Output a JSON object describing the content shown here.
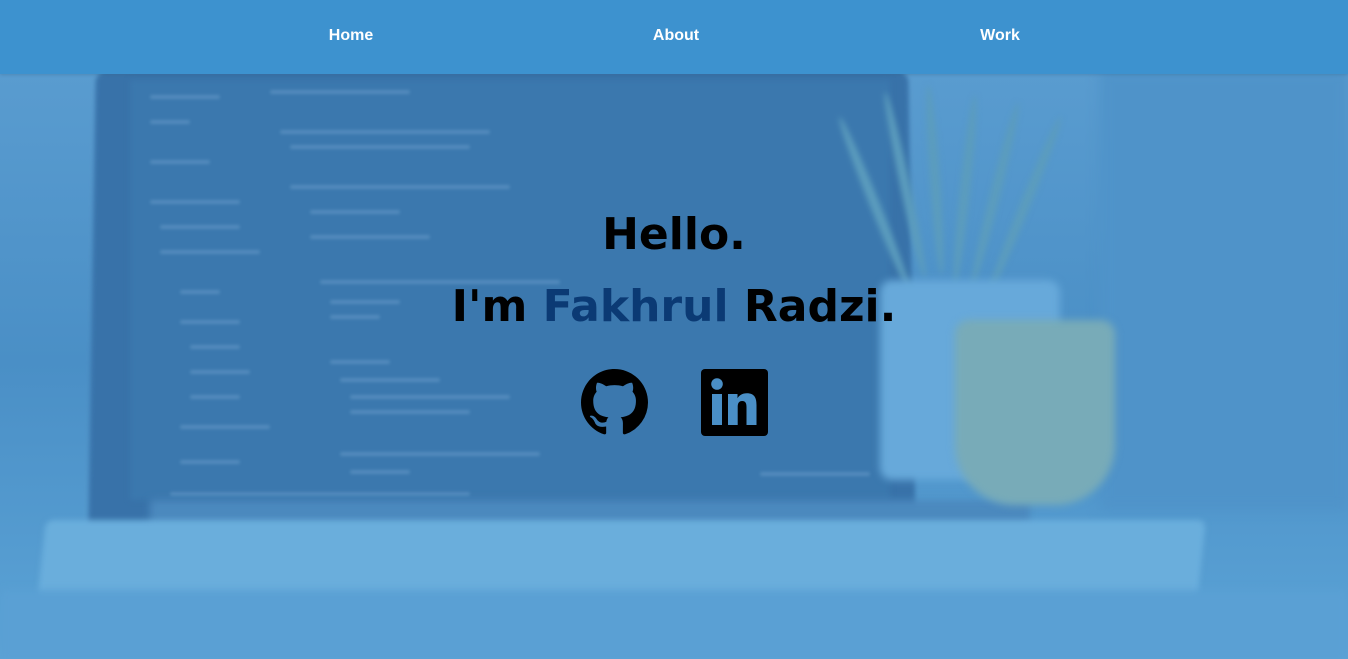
{
  "nav": {
    "items": [
      {
        "label": "Home"
      },
      {
        "label": "About"
      },
      {
        "label": "Work"
      }
    ]
  },
  "hero": {
    "greeting": "Hello.",
    "intro_prefix": "I'm",
    "name_highlight": "Fakhrul",
    "name_suffix": "Radzi."
  },
  "social": [
    {
      "icon": "github-icon"
    },
    {
      "icon": "linkedin-icon"
    }
  ],
  "colors": {
    "navbar": "#3d92cf",
    "nav_text": "#ffffff",
    "heading_text": "#000000",
    "name_highlight": "#0b3a74",
    "backdrop": "#4a92c9"
  }
}
